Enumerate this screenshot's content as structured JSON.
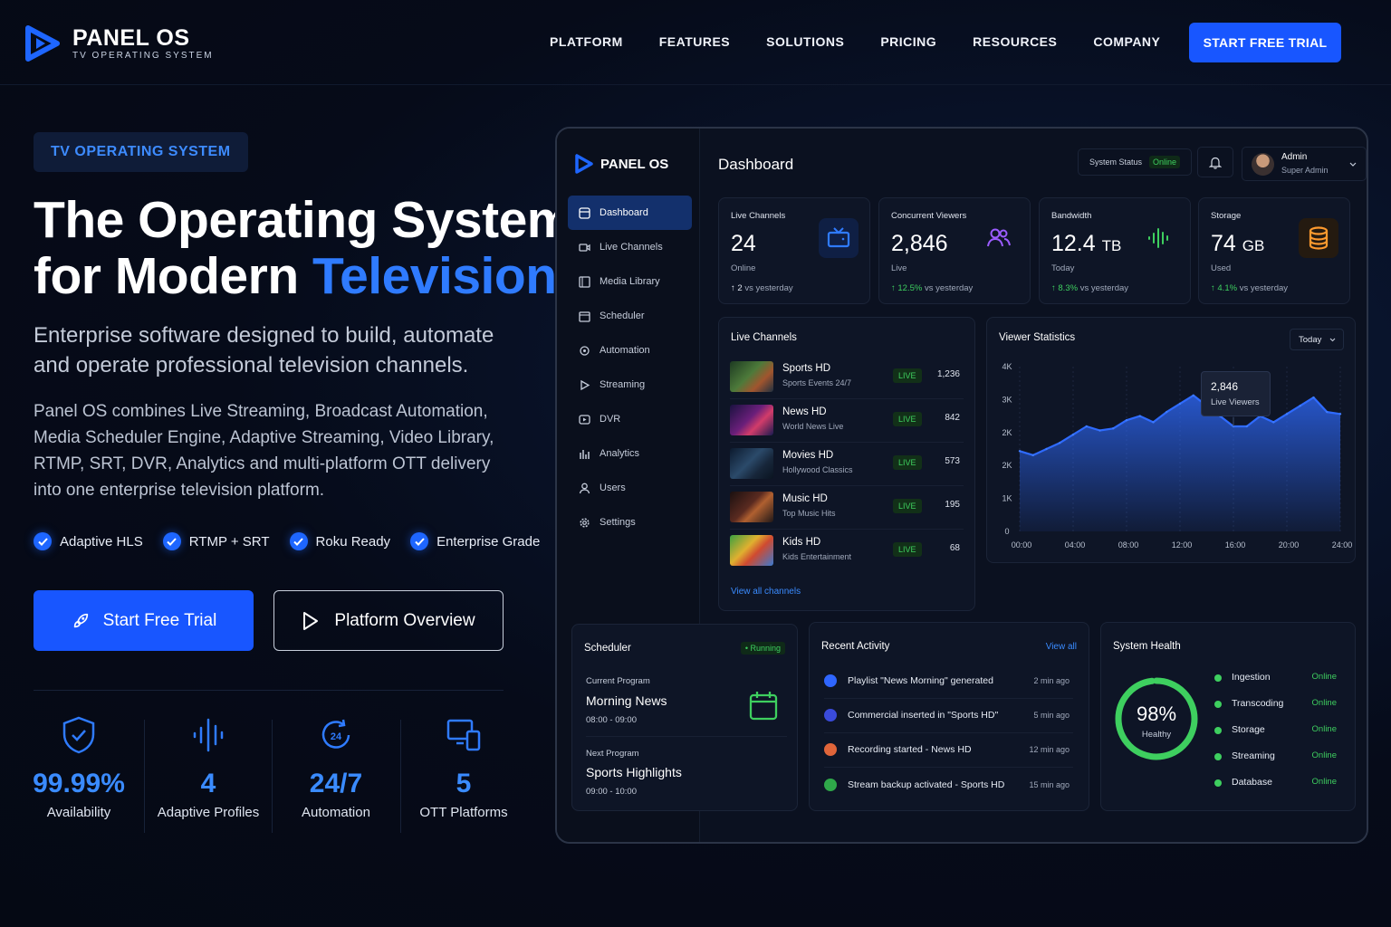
{
  "brand": {
    "name": "PANEL OS",
    "tagline": "TV OPERATING SYSTEM"
  },
  "nav": {
    "items": [
      "PLATFORM",
      "FEATURES",
      "SOLUTIONS",
      "PRICING",
      "RESOURCES",
      "COMPANY"
    ],
    "cta": "START FREE TRIAL"
  },
  "hero": {
    "pill": "TV OPERATING SYSTEM",
    "title_line1": "The Operating System",
    "title_line2_prefix": "for Modern ",
    "title_line2_accent": "Television",
    "lead": "Enterprise software designed to build, automate and operate professional television channels.",
    "body": "Panel OS combines Live Streaming, Broadcast Automation, Media Scheduler Engine, Adaptive Streaming, Video Library, RTMP, SRT, DVR, Analytics and multi-platform OTT delivery into one enterprise television platform.",
    "checks": [
      "Adaptive HLS",
      "RTMP + SRT",
      "Roku Ready",
      "Enterprise Grade"
    ],
    "primary_button": "Start Free Trial",
    "secondary_button": "Platform Overview",
    "stats": [
      {
        "value": "99.99%",
        "label": "Availability",
        "icon": "shield-check-icon"
      },
      {
        "value": "4",
        "label": "Adaptive Profiles",
        "icon": "waveform-icon"
      },
      {
        "value": "24/7",
        "label": "Automation",
        "icon": "clock-24-icon"
      },
      {
        "value": "5",
        "label": "OTT Platforms",
        "icon": "devices-icon"
      }
    ]
  },
  "dashboard": {
    "brand": "PANEL OS",
    "title": "Dashboard",
    "menu": [
      "Dashboard",
      "Live Channels",
      "Media Library",
      "Scheduler",
      "Automation",
      "Streaming",
      "DVR",
      "Analytics",
      "Users",
      "Settings"
    ],
    "system_status_label": "System Status",
    "system_status_value": "Online",
    "admin_name": "Admin",
    "admin_role": "Super Admin",
    "kpis": [
      {
        "label": "Live Channels",
        "value": "24",
        "unit": "",
        "sub": "Online",
        "trend_value": "2",
        "trend_text": "vs yesterday",
        "color": "#2f7bff"
      },
      {
        "label": "Concurrent Viewers",
        "value": "2,846",
        "unit": "",
        "sub": "Live",
        "trend_value": "12.5%",
        "trend_text": "vs yesterday",
        "color": "#9b5cff"
      },
      {
        "label": "Bandwidth",
        "value": "12.4",
        "unit": "TB",
        "sub": "Today",
        "trend_value": "8.3%",
        "trend_text": "vs yesterday",
        "color": "#3ecf5f"
      },
      {
        "label": "Storage",
        "value": "74",
        "unit": "GB",
        "sub": "Used",
        "trend_value": "4.1%",
        "trend_text": "vs yesterday",
        "color": "#ff9a2e"
      }
    ],
    "live_channels": {
      "title": "Live Channels",
      "badge": "LIVE",
      "rows": [
        {
          "name": "Sports HD",
          "sub": "Sports Events 24/7",
          "viewers": "1,236"
        },
        {
          "name": "News HD",
          "sub": "World News Live",
          "viewers": "842"
        },
        {
          "name": "Movies HD",
          "sub": "Hollywood Classics",
          "viewers": "573"
        },
        {
          "name": "Music HD",
          "sub": "Top Music Hits",
          "viewers": "195"
        },
        {
          "name": "Kids HD",
          "sub": "Kids Entertainment",
          "viewers": "68"
        }
      ],
      "link": "View all channels"
    },
    "viewer_stats": {
      "title": "Viewer Statistics",
      "range": "Today",
      "tooltip_value": "2,846",
      "tooltip_label": "Live Viewers"
    },
    "scheduler": {
      "title": "Scheduler",
      "status": "Running",
      "current_label": "Current Program",
      "current_name": "Morning News",
      "current_time": "08:00 - 09:00",
      "next_label": "Next Program",
      "next_name": "Sports Highlights",
      "next_time": "09:00 - 10:00"
    },
    "activity": {
      "title": "Recent Activity",
      "link": "View all",
      "rows": [
        {
          "text": "Playlist \"News Morning\" generated",
          "time": "2 min ago",
          "color": "#2f66ff"
        },
        {
          "text": "Commercial inserted in \"Sports HD\"",
          "time": "5 min ago",
          "color": "#3a4bdb"
        },
        {
          "text": "Recording started - News HD",
          "time": "12 min ago",
          "color": "#e0653a"
        },
        {
          "text": "Stream backup activated - Sports HD",
          "time": "15 min ago",
          "color": "#2fa84a"
        }
      ]
    },
    "health": {
      "title": "System Health",
      "percent_text": "98%",
      "percent": 98,
      "label": "Healthy",
      "rows": [
        {
          "name": "Ingestion",
          "status": "Online"
        },
        {
          "name": "Transcoding",
          "status": "Online"
        },
        {
          "name": "Storage",
          "status": "Online"
        },
        {
          "name": "Streaming",
          "status": "Online"
        },
        {
          "name": "Database",
          "status": "Online"
        }
      ]
    }
  },
  "chart_data": {
    "type": "area",
    "title": "Viewer Statistics",
    "x": [
      "00:00",
      "01:00",
      "02:00",
      "03:00",
      "04:00",
      "05:00",
      "06:00",
      "07:00",
      "08:00",
      "09:00",
      "10:00",
      "11:00",
      "12:00",
      "13:00",
      "14:00",
      "15:00",
      "16:00",
      "17:00",
      "18:00",
      "19:00",
      "20:00",
      "21:00",
      "22:00",
      "23:00",
      "24:00"
    ],
    "x_tick_labels": [
      "00:00",
      "04:00",
      "08:00",
      "12:00",
      "16:00",
      "20:00",
      "24:00"
    ],
    "y_tick_labels": [
      "0",
      "1K",
      "2K",
      "2K",
      "3K",
      "4K"
    ],
    "series": [
      {
        "values": [
          1950,
          1850,
          2000,
          2150,
          2350,
          2550,
          2450,
          2500,
          2700,
          2800,
          2650,
          2900,
          3100,
          3300,
          3050,
          2800,
          2550,
          2550,
          2800,
          2650,
          2850,
          3050,
          3250,
          2900,
          2850
        ]
      }
    ],
    "ylim": [
      0,
      4000
    ],
    "grid": "vertical dashed",
    "color": "#2f6bff"
  }
}
